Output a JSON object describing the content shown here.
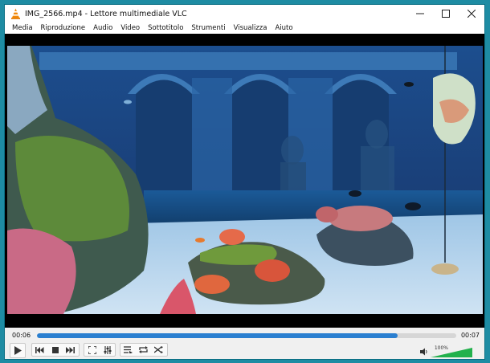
{
  "window": {
    "title": "IMG_2566.mp4 - Lettore multimediale VLC"
  },
  "menu": {
    "items": [
      "Media",
      "Riproduzione",
      "Audio",
      "Video",
      "Sottotitolo",
      "Strumenti",
      "Visualizza",
      "Aiuto"
    ]
  },
  "player": {
    "elapsed": "00:06",
    "total": "00:07",
    "progress": 0.86,
    "volume_label": "100%",
    "volume": 1.0,
    "accent_color": "#2a7fd0",
    "volume_color": "#22b14c"
  },
  "icons": {
    "app": "vlc-cone-icon",
    "minimize": "minimize-icon",
    "maximize": "maximize-icon",
    "close": "close-icon",
    "play": "play-icon",
    "previous": "previous-icon",
    "stop": "stop-icon",
    "next": "next-icon",
    "fullscreen": "fullscreen-icon",
    "extended_settings": "equalizer-icon",
    "playlist": "playlist-icon",
    "loop": "loop-icon",
    "shuffle": "shuffle-icon",
    "speaker": "speaker-icon"
  }
}
